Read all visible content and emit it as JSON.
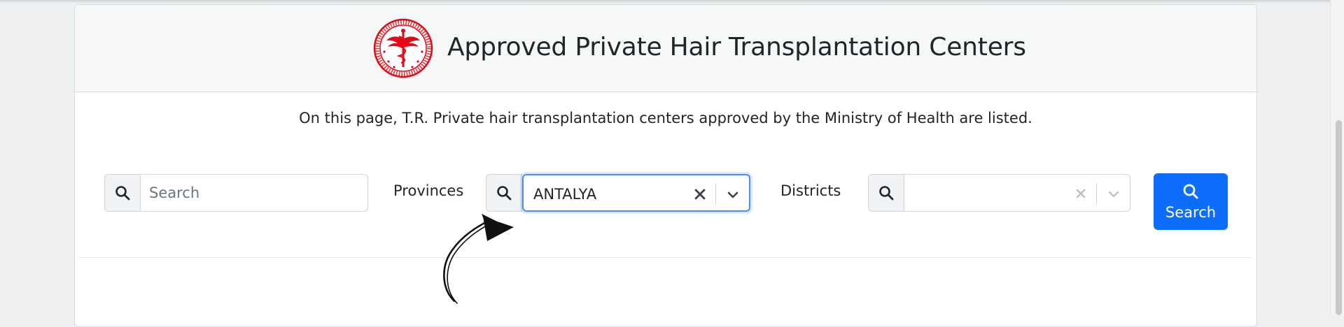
{
  "header": {
    "title": "Approved Private Hair Transplantation Centers",
    "logo_icon": "ministry-of-health-seal-icon",
    "logo_color": "#e30a17"
  },
  "description": "On this page, T.R. Private hair transplantation centers approved by the Ministry of Health are listed.",
  "filters": {
    "search": {
      "placeholder": "Search",
      "value": "",
      "icon": "search-icon"
    },
    "provinces": {
      "label": "Provinces",
      "selected": "ANTALYA",
      "icon": "search-icon"
    },
    "districts": {
      "label": "Districts",
      "selected": "",
      "icon": "search-icon"
    }
  },
  "search_button": {
    "label": "Search",
    "icon": "search-icon",
    "color": "#0d6efd"
  },
  "annotation": {
    "icon": "hand-drawn-arrow-icon"
  }
}
